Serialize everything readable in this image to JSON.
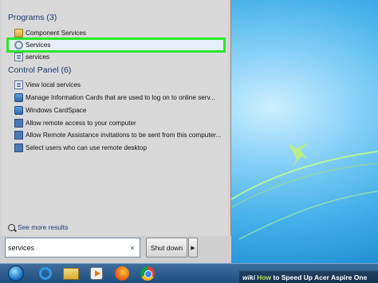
{
  "programs": {
    "header": "Programs (3)",
    "items": [
      {
        "label": "Component Services",
        "icon": "folder-icon"
      },
      {
        "label": "Services",
        "icon": "gear-icon"
      },
      {
        "label": "services",
        "icon": "document-icon"
      }
    ]
  },
  "control_panel": {
    "header": "Control Panel (6)",
    "items": [
      {
        "label": "View local services",
        "icon": "document-icon"
      },
      {
        "label": "Manage Information Cards that are used to log on to online serv...",
        "icon": "card-icon"
      },
      {
        "label": "Windows CardSpace",
        "icon": "card-icon"
      },
      {
        "label": "Allow remote access to your computer",
        "icon": "computer-icon"
      },
      {
        "label": "Allow Remote Assistance invitations to be sent from this computer...",
        "icon": "computer-icon"
      },
      {
        "label": "Select users who can use remote desktop",
        "icon": "computer-icon"
      }
    ]
  },
  "see_more": "See more results",
  "search": {
    "value": "services",
    "clear": "×"
  },
  "shutdown": {
    "label": "Shut down",
    "arrow": "▶"
  },
  "taskbar": {
    "items": [
      "start-orb",
      "internet-explorer",
      "windows-explorer",
      "media-player",
      "firefox",
      "chrome"
    ]
  },
  "watermark": {
    "wiki": "wiki",
    "how": "How",
    "rest": " to Speed Up Acer Aspire One"
  },
  "colors": {
    "highlight": "#2ae82a",
    "header_text": "#1e3a6e",
    "taskbar": "#1f4d7d"
  }
}
